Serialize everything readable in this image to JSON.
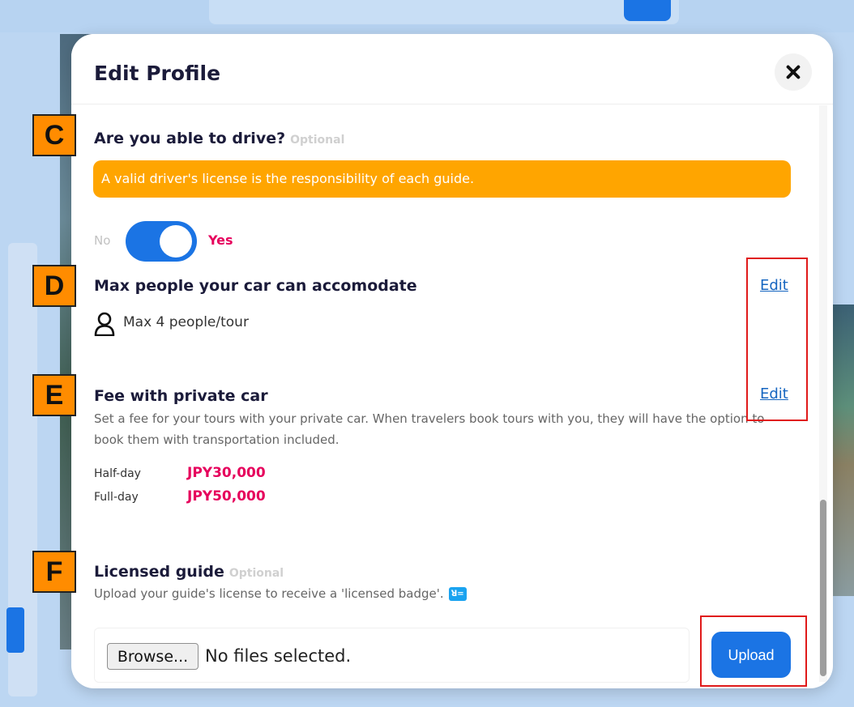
{
  "modal": {
    "title": "Edit Profile",
    "close_icon": "close-icon"
  },
  "drive": {
    "marker": "C",
    "title": "Are you able to drive?",
    "optional": "Optional",
    "notice": "A valid driver's license is the responsibility of each guide.",
    "toggle_off_label": "No",
    "toggle_on_label": "Yes",
    "toggle_state": "on"
  },
  "capacity": {
    "marker": "D",
    "title": "Max people your car can accomodate",
    "edit_label": "Edit",
    "icon": "person-icon",
    "value": "Max 4 people/tour"
  },
  "fee": {
    "marker": "E",
    "title": "Fee with private car",
    "edit_label": "Edit",
    "description": "Set a fee for your tours with your private car. When travelers book tours with you, they will have the option to book them with transportation included.",
    "rows": [
      {
        "label": "Half-day",
        "value": "JPY30,000"
      },
      {
        "label": "Full-day",
        "value": "JPY50,000"
      }
    ]
  },
  "licensed": {
    "marker": "F",
    "title": "Licensed guide",
    "optional": "Optional",
    "description": "Upload your guide's license to receive a 'licensed badge'.",
    "badge_icon_text": "ꓤ=",
    "browse_label": "Browse...",
    "file_status": "No files selected.",
    "upload_label": "Upload"
  },
  "colors": {
    "accent_blue": "#1b74e4",
    "notice_orange": "#ffa500",
    "price_pink": "#e6005c",
    "annotation_orange": "#ff8c00",
    "annotation_red": "#e01a1a"
  }
}
